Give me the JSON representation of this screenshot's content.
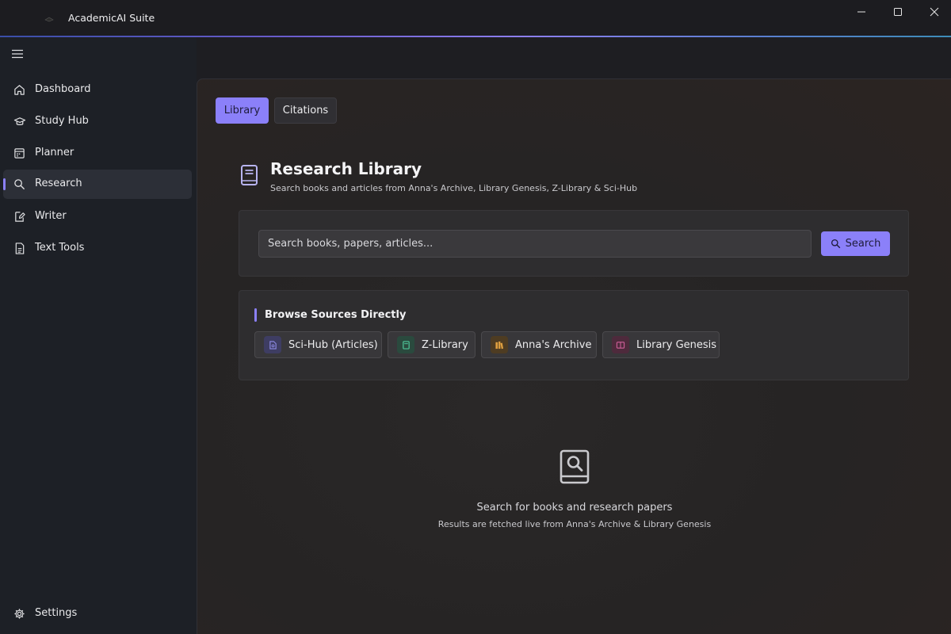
{
  "app": {
    "title": "AcademicAI Suite"
  },
  "window_controls": [
    "minimize-icon",
    "maximize-icon",
    "close-icon"
  ],
  "sidebar": {
    "items": [
      {
        "label": "Dashboard",
        "icon": "home-icon"
      },
      {
        "label": "Study Hub",
        "icon": "graduation-cap-icon"
      },
      {
        "label": "Planner",
        "icon": "calendar-icon"
      },
      {
        "label": "Research",
        "icon": "search-icon",
        "active": true
      },
      {
        "label": "Writer",
        "icon": "pen-icon"
      },
      {
        "label": "Text Tools",
        "icon": "document-icon"
      }
    ],
    "settings": {
      "label": "Settings",
      "icon": "gear-icon"
    }
  },
  "tabs": [
    {
      "label": "Library",
      "active": true
    },
    {
      "label": "Citations",
      "active": false
    }
  ],
  "header": {
    "title": "Research Library",
    "subtitle": "Search books and articles from Anna's Archive, Library Genesis, Z-Library & Sci-Hub"
  },
  "search": {
    "placeholder": "Search books, papers, articles...",
    "value": "",
    "button_label": "Search"
  },
  "sources": {
    "heading": "Browse Sources Directly",
    "items": [
      {
        "label": "Sci-Hub (Articles)",
        "color": "#7b79d8"
      },
      {
        "label": "Z-Library",
        "color": "#3fb98a"
      },
      {
        "label": "Anna's Archive",
        "color": "#e0a040"
      },
      {
        "label": "Library Genesis",
        "color": "#d0609a"
      }
    ]
  },
  "empty_state": {
    "title": "Search for books and research papers",
    "subtitle": "Results are fetched live from Anna's Archive & Library Genesis"
  },
  "colors": {
    "accent": "#8b80f9",
    "sidebar_bg": "#1d2026",
    "main_bg": "#262424"
  }
}
